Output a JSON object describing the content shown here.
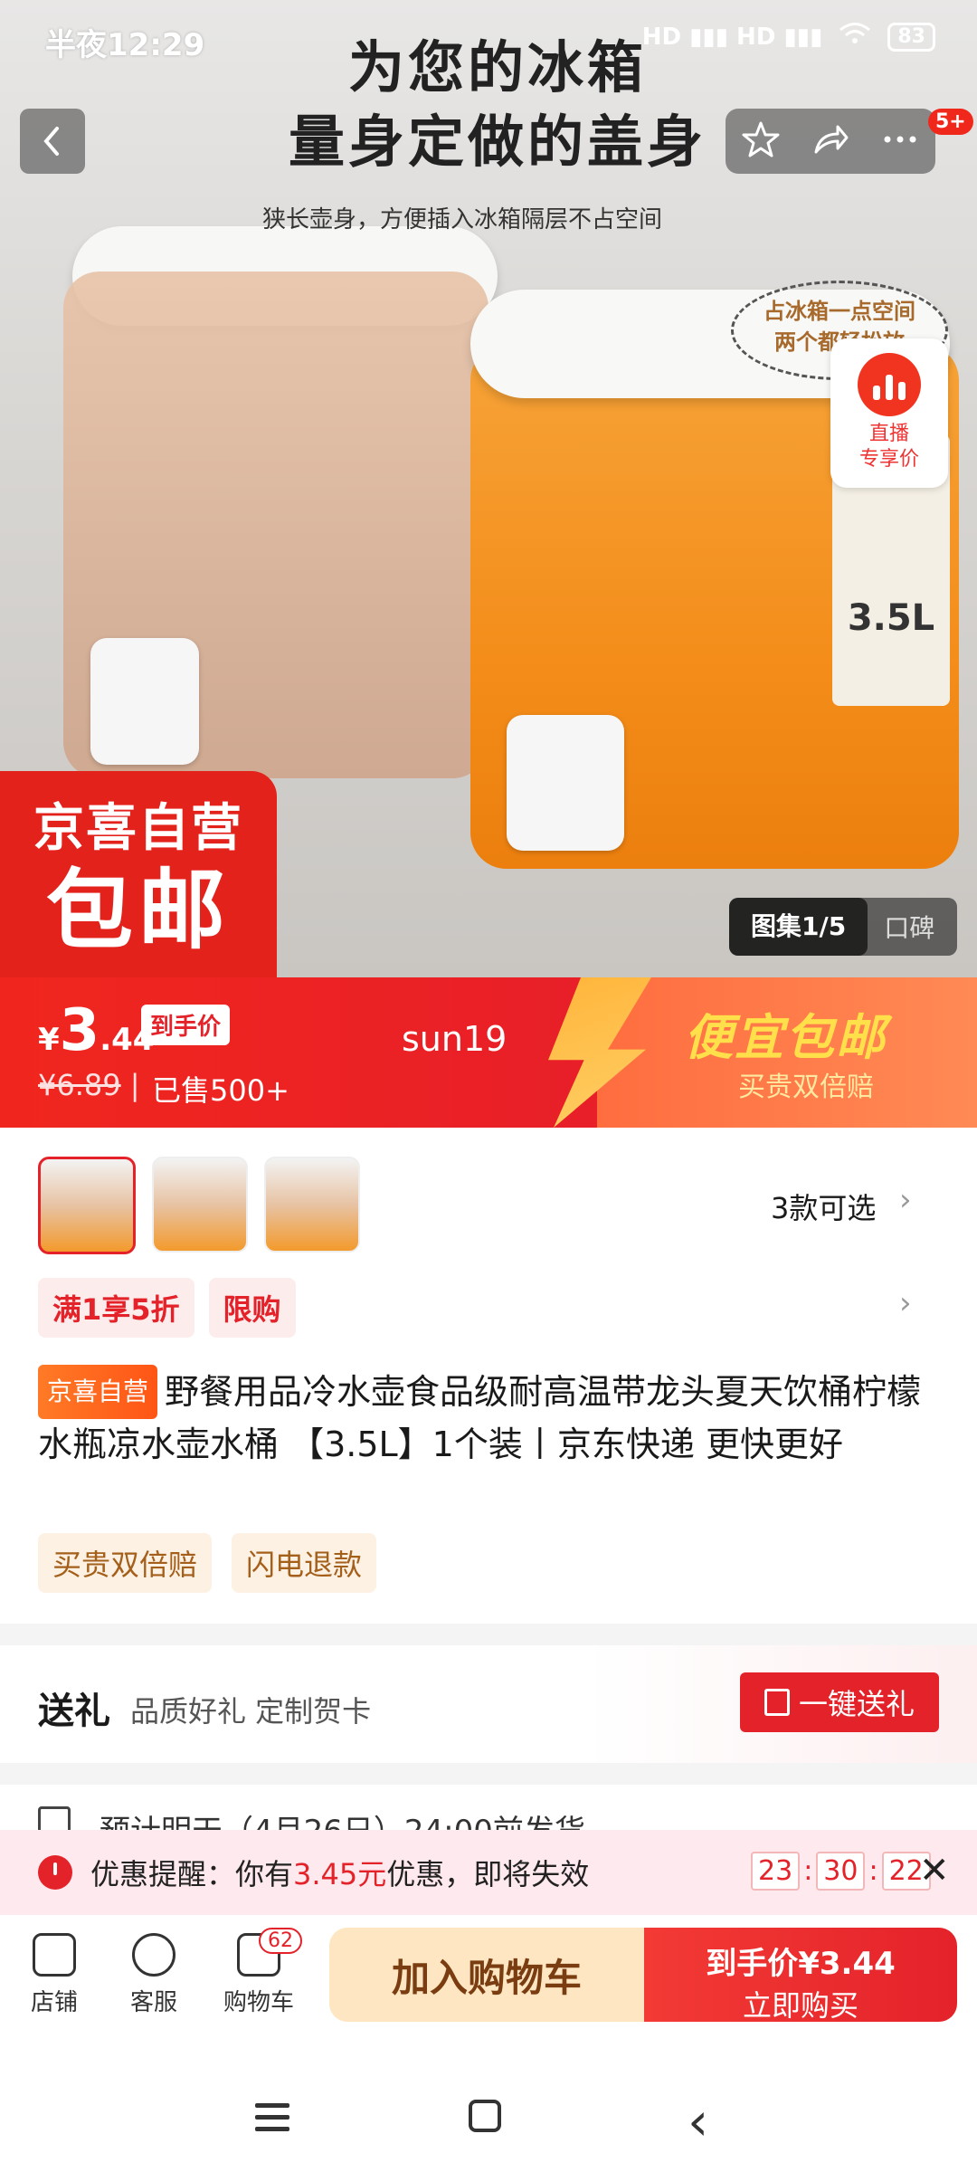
{
  "status_bar": {
    "time": "半夜12:29",
    "signal": "HD ▮▮▮ HD ▮▮▮",
    "battery": "83"
  },
  "hero": {
    "headline_line1": "为您的冰箱",
    "headline_line2": "量身定做的盖身",
    "subline": "狭长壶身，方便插入冰箱隔层不占空间",
    "bubble_line1": "占冰箱一点空间",
    "bubble_line2": "两个都轻松放",
    "label_text": "3.5L",
    "more_badge": "5+",
    "live_line1": "直播",
    "live_line2": "专享价",
    "promo_line1": "京喜自营",
    "promo_line2": "包邮",
    "gallery_label": "图集1/5",
    "reviews_label": "口碑"
  },
  "price_banner": {
    "currency": "¥",
    "price_int": "3",
    "price_dec": ".44",
    "reach_tag": "到手价",
    "original_price": "¥6.89",
    "sold": "已售500+",
    "watermark": "sun19",
    "promo_title": "便宜包邮",
    "promo_sub": "买贵双倍赔"
  },
  "variants": {
    "count_label": "3款可选"
  },
  "tags": {
    "discount": "满1享5折",
    "limit": "限购"
  },
  "product": {
    "store_badge": "京喜自营",
    "title": "野餐用品冷水壶食品级耐高温带龙头夏天饮桶柠檬水瓶凉水壶水桶 【3.5L】1个装丨京东快递 更快更好"
  },
  "services": [
    "买贵双倍赔",
    "闪电退款"
  ],
  "gift": {
    "title": "送礼",
    "subtitle": "品质好礼 定制贺卡",
    "button": "一键送礼"
  },
  "shipping": {
    "text": "预计明天（4月26日）24:00前发货"
  },
  "reminder": {
    "prefix": "优惠提醒：你有",
    "amount": "3.45元",
    "suffix": "优惠，即将失效",
    "h": "23",
    "m": "30",
    "s": "22"
  },
  "bottom_bar": {
    "store": "店铺",
    "service": "客服",
    "cart": "购物车",
    "cart_count": "62",
    "add_cart": "加入购物车",
    "buy_line1": "到手价¥3.44",
    "buy_line2": "立即购买"
  }
}
